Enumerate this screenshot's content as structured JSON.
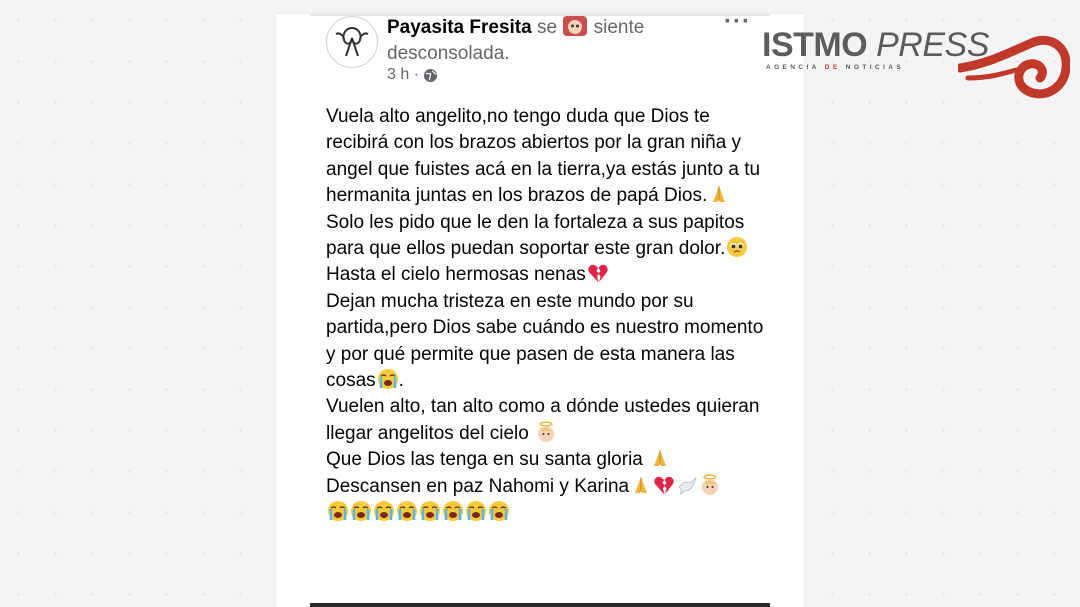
{
  "post": {
    "author": "Payasita Fresita",
    "verb": "se",
    "feeling_word": "siente",
    "feeling_value": "desconsolada.",
    "time": "3 h ·",
    "menu": "···"
  },
  "body": {
    "p1": "Vuela alto angelito,no tengo duda que Dios te recibirá con los brazos abiertos por la gran niña y angel que fuistes acá en la tierra,ya estás junto a tu hermanita juntas en los brazos de papá Dios.",
    "p2": "Solo les pido que le den la fortaleza a sus papitos para que ellos puedan soportar este gran dolor.",
    "p3": "Hasta el cielo hermosas nenas",
    "p4": "Dejan mucha tristeza en este mundo por su partida,pero Dios sabe cuándo es nuestro momento y por qué permite que pasen de esta manera las cosas",
    "p4_end": ".",
    "p5": "Vuelen alto, tan alto como a dónde ustedes quieran llegar angelitos del cielo",
    "p6": "Que Dios las tenga en su santa gloria",
    "p7": "Descansen en paz Nahomi y Karina"
  },
  "logo": {
    "word1": "ISTMO",
    "word2": "PRESS",
    "sub_a": "AGENCIA ",
    "sub_b": "DE",
    "sub_c": " NOTICIAS"
  },
  "colors": {
    "accent_red": "#c0392b",
    "logo_gray": "#5c5c5c",
    "meta_gray": "#65676b"
  },
  "icons": {
    "pray": "pray-emoji",
    "pleading": "pleading-emoji",
    "broken_heart": "broken-heart-emoji",
    "crying": "loudly-crying-emoji",
    "angel": "angel-baby-emoji",
    "dove": "dove-emoji"
  }
}
